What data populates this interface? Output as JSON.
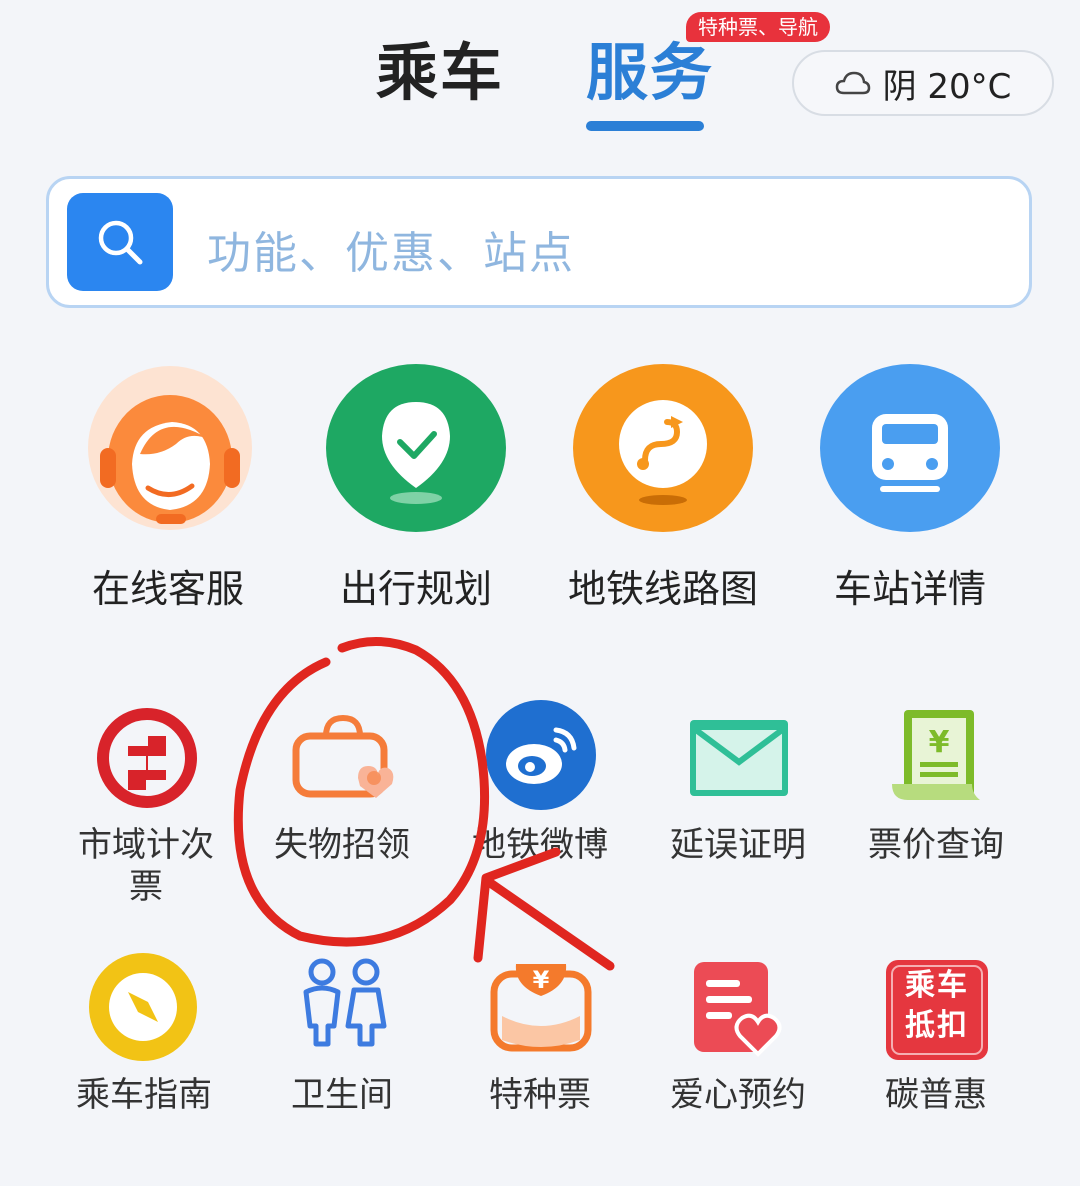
{
  "header": {
    "tabs": [
      {
        "label": "乘车",
        "active": false
      },
      {
        "label": "服务",
        "active": true
      }
    ],
    "badge": "特种票、导航",
    "weather": {
      "icon": "cloud-icon",
      "text": "阴 20°C"
    }
  },
  "search": {
    "icon": "search-icon",
    "placeholder": "功能、优惠、站点"
  },
  "primary_services": [
    {
      "label": "在线客服",
      "icon": "customer-service-icon",
      "color": "#fb8a3c"
    },
    {
      "label": "出行规划",
      "icon": "location-pin-icon",
      "color": "#1ea863"
    },
    {
      "label": "地铁线路图",
      "icon": "route-icon",
      "color": "#f7971c"
    },
    {
      "label": "车站详情",
      "icon": "train-icon",
      "color": "#4a9ef0"
    }
  ],
  "services": [
    {
      "label": "市域计次票",
      "icon": "city-ticket-icon",
      "color": "#d8232a"
    },
    {
      "label": "失物招领",
      "icon": "lost-bag-icon",
      "color": "#f57c3a"
    },
    {
      "label": "地铁微博",
      "icon": "weibo-icon",
      "color": "#1f6fd0"
    },
    {
      "label": "延误证明",
      "icon": "envelope-icon",
      "color": "#2fbf97"
    },
    {
      "label": "票价查询",
      "icon": "receipt-icon",
      "color": "#7dbb2a"
    },
    {
      "label": "乘车指南",
      "icon": "compass-icon",
      "color": "#f2c315"
    },
    {
      "label": "卫生间",
      "icon": "restroom-icon",
      "color": "#3d7be0"
    },
    {
      "label": "特种票",
      "icon": "special-ticket-icon",
      "color": "#f47a2c"
    },
    {
      "label": "爱心预约",
      "icon": "heart-reserve-icon",
      "color": "#ec4b55"
    },
    {
      "label": "碳普惠",
      "icon": "ride-discount-icon",
      "color": "#e5373f",
      "icon_text": "乘车抵扣"
    }
  ],
  "annotation": {
    "color": "#e0261f"
  }
}
